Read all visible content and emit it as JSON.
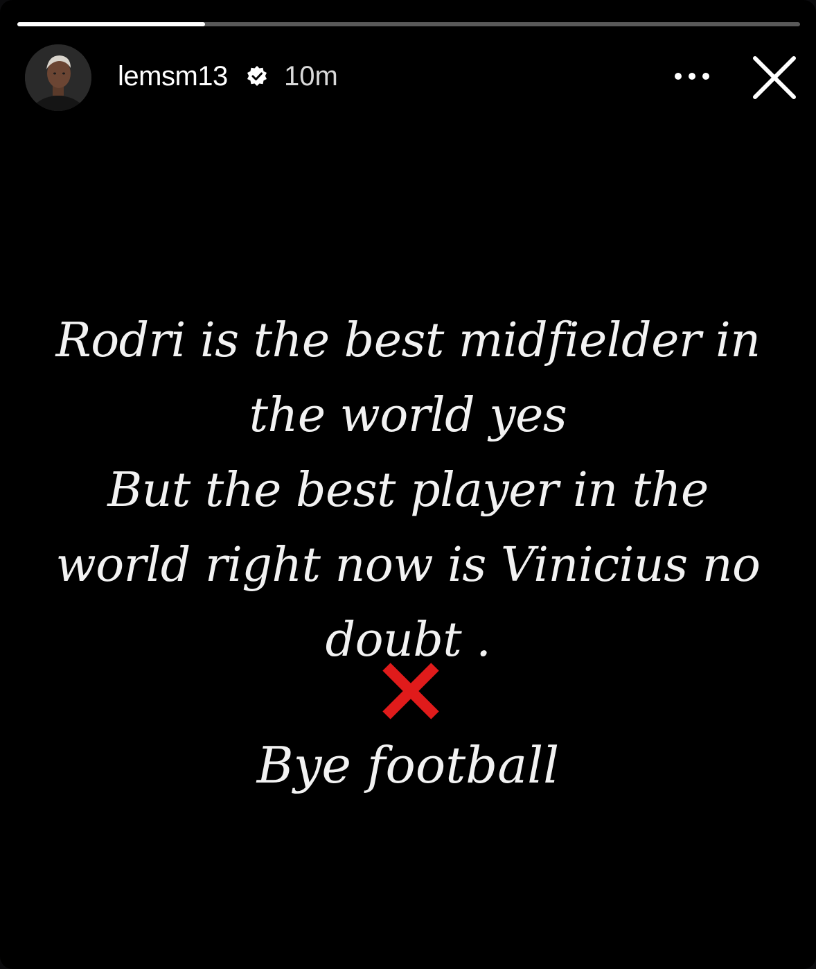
{
  "story": {
    "progress_fraction": 0.24,
    "username": "lemsm13",
    "verified": true,
    "timestamp": "10m",
    "more_icon": "more-horizontal-icon",
    "close_icon": "close-icon"
  },
  "content": {
    "lines": [
      "Rodri is the best midfielder in",
      "the world yes",
      "But the best player in the",
      "world right now is Vinicius no",
      "doubt ."
    ],
    "emoji": "cross-mark-icon",
    "closing": "Bye football"
  },
  "colors": {
    "background": "#000000",
    "text": "#f2f2f2",
    "cross_red": "#e01b1b"
  }
}
